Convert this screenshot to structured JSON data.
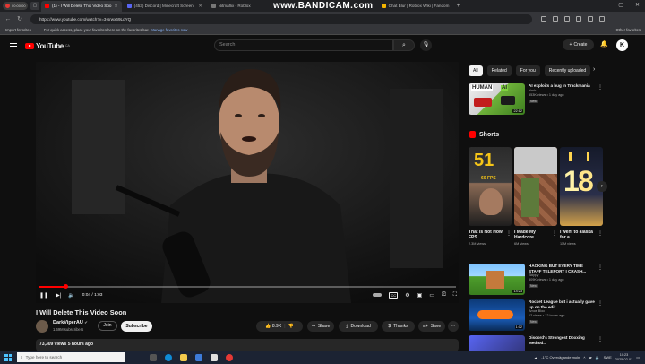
{
  "browser": {
    "recording_text": "00:00:00",
    "tabs": [
      {
        "label": "(1) - I Will Delete This Video Soo",
        "active": true,
        "color": "#ff0000"
      },
      {
        "label": "(453) Discord | Minecraft Screenl",
        "active": false,
        "color": "#5865f2"
      },
      {
        "label": "Nitmaflix - Roblox",
        "active": false,
        "color": "#777777"
      },
      {
        "label": "",
        "active": false,
        "color": "#777777"
      },
      {
        "label": "Chat Blur | Roblox Wiki | Fandom",
        "active": false,
        "color": "#f4b400"
      }
    ],
    "watermark": "www.BANDICAM.com",
    "url": "https://www.youtube.com/watch?v=3-srwx69LdYQ",
    "bookmarks": {
      "import": "Import favorites",
      "message": "For quick access, place your favorites here on the favorites bar.",
      "link": "Manage favorites now",
      "other": "Other favorites"
    }
  },
  "youtube": {
    "logo_text": "YouTube",
    "logo_country": "CA",
    "search_placeholder": "Search",
    "create_label": "Create",
    "avatar_letter": "K"
  },
  "player": {
    "progress": 0.064,
    "current_time": "0:04",
    "duration": "1:03",
    "time_text": "0:04 / 1:03"
  },
  "video": {
    "title": "I Will Delete This Video Soon",
    "channel": "DarkViperAU",
    "verified": "✔",
    "subscribers": "1.69M subscribers",
    "join_label": "Join",
    "subscribe_label": "Subscribe",
    "likes": "8.9K",
    "share_label": "Share",
    "download_label": "Download",
    "thanks_label": "Thanks",
    "save_label": "Save",
    "views_line": "73,309 views  5 hours ago"
  },
  "sidebar": {
    "chips": [
      "All",
      "Related",
      "For you",
      "Recently uploaded"
    ],
    "top_video": {
      "title": "AI exploits a bug in Trackmania",
      "channel": "Yosh",
      "meta": "553K views • 1 day ago",
      "badge": "New",
      "duration": "22:12"
    },
    "shorts_title": "Shorts",
    "shorts": [
      {
        "title": "That Is Not How FPS ...",
        "views": "2.3M views"
      },
      {
        "title": "I Made My Hardcore ...",
        "views": "6M views"
      },
      {
        "title": "I went to alaska for a...",
        "views": "11M views"
      }
    ],
    "videos": [
      {
        "title": "HACKING BUT EVERY TIME STAFF TELEPORT I CRASH...",
        "channel": "Skippy",
        "meta": "509K views • 1 day ago",
        "badge": "New",
        "duration": "14:23"
      },
      {
        "title": "Rocket League but i actually gave up on the edit...",
        "channel": "Amos Bloc",
        "meta": "12 views • 12 hours ago",
        "badge": "New",
        "duration": "1:02"
      },
      {
        "title": "Discord's Strongest Doxxing Method...",
        "channel": "",
        "meta": "",
        "badge": "",
        "duration": ""
      }
    ]
  },
  "taskbar": {
    "search_placeholder": "Type here to search",
    "weather": "-1°C  Overvägande moln",
    "lang": "SWE",
    "time": "10:23",
    "date": "2025-02-01"
  }
}
